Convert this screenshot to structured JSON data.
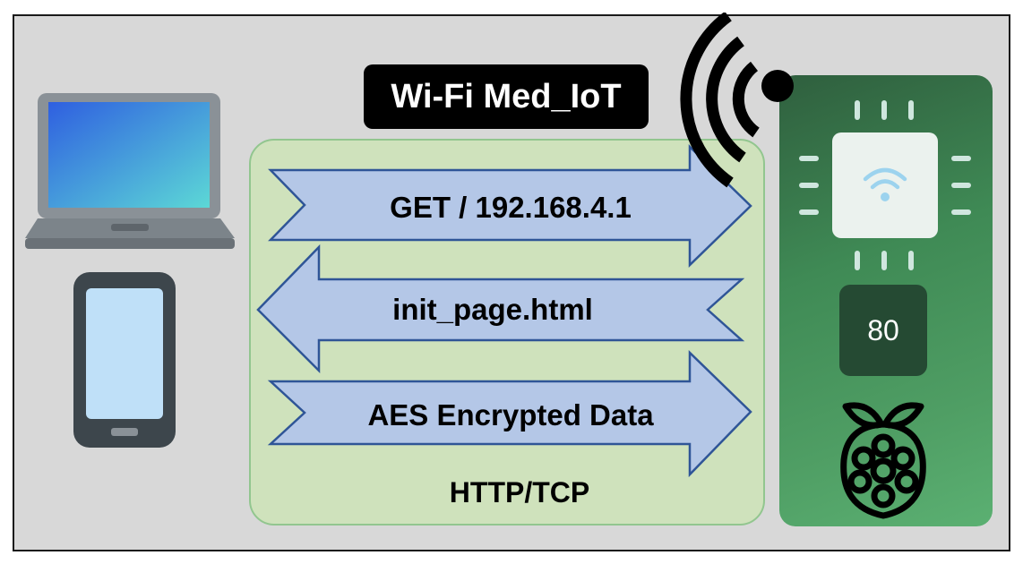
{
  "wifi": {
    "ssid_label": "Wi-Fi Med_IoT"
  },
  "flows": [
    {
      "label": "GET / 192.168.4.1",
      "direction": "to-device"
    },
    {
      "label": "init_page.html",
      "direction": "to-client"
    },
    {
      "label": "AES Encrypted Data",
      "direction": "to-device"
    }
  ],
  "protocol": {
    "label": "HTTP/TCP"
  },
  "device": {
    "port_number": "80"
  },
  "colors": {
    "background": "#d8d8d8",
    "protocol_box": "#cfe2bc",
    "arrow_fill": "#b4c7e7",
    "arrow_stroke": "#2f5597",
    "board": "#3f8a55"
  }
}
